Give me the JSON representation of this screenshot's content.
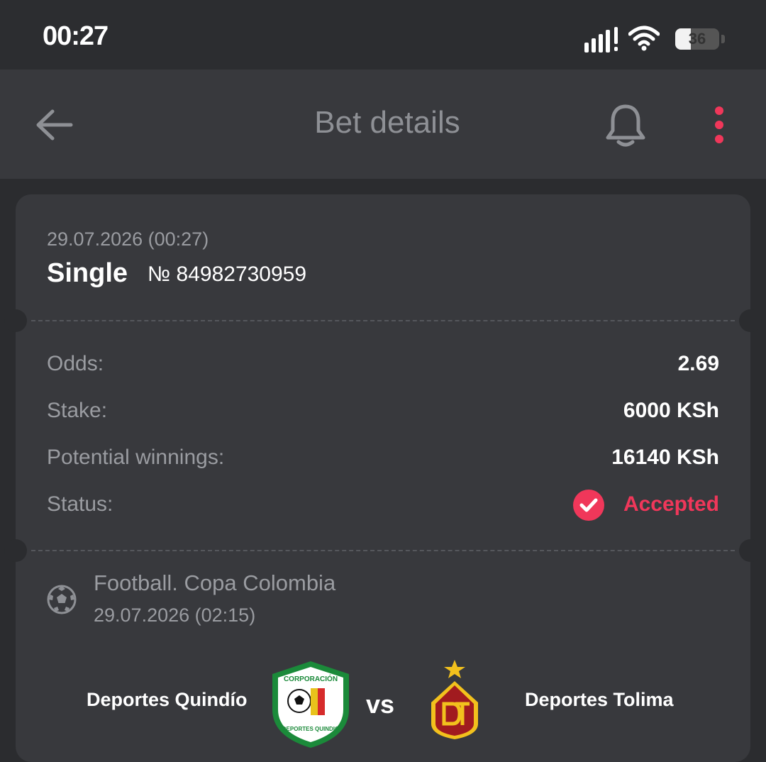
{
  "status_bar": {
    "time": "00:27",
    "battery_level": "36"
  },
  "app_bar": {
    "title": "Bet details"
  },
  "bet": {
    "date": "29.07.2026 (00:27)",
    "type": "Single",
    "number": "№ 84982730959"
  },
  "details": {
    "odds_label": "Odds:",
    "odds_value": "2.69",
    "stake_label": "Stake:",
    "stake_value": "6000 KSh",
    "winnings_label": "Potential winnings:",
    "winnings_value": "16140 KSh",
    "status_label": "Status:",
    "status_value": "Accepted"
  },
  "event": {
    "sport_league": "Football. Copa Colombia",
    "date": "29.07.2026 (02:15)",
    "home_team": "Deportes Quindío",
    "vs": "vs",
    "away_team": "Deportes Tolima",
    "home_logo_text_top": "CORPORACIÓN",
    "home_logo_text_bottom": "DEPORTES QUINDIO"
  },
  "colors": {
    "accent": "#f0375a",
    "background": "#2b2c2f",
    "card": "#38393d"
  },
  "icons": {
    "back": "arrow-left-icon",
    "notifications": "bell-icon",
    "more": "more-vertical-icon",
    "status": "check-circle-icon",
    "sport": "soccer-ball-icon"
  }
}
